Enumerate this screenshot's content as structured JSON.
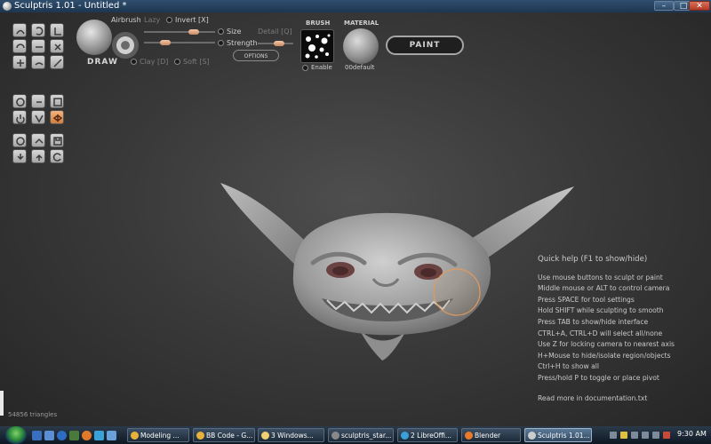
{
  "window": {
    "title": "Sculptris 1.01 - Untitled *",
    "minimize": "–",
    "maximize": "□",
    "close": "✕"
  },
  "brush": {
    "tool_name": "DRAW",
    "airbrush_label": "Airbrush",
    "lazy_label": "Lazy",
    "invert_label": "Invert [X]",
    "size_label": "Size",
    "detail_label": "Detail [Q]",
    "strength_label": "Strength",
    "clay_label": "Clay [D]",
    "soft_label": "Soft [S]",
    "options_label": "OPTIONS",
    "brush_header": "BRUSH",
    "enable_label": "Enable",
    "material_header": "MATERIAL",
    "material_name": "00default",
    "paint_label": "PAINT",
    "size_value": 0.7,
    "strength_value": 0.3,
    "detail_value": 0.6
  },
  "tools": [
    {
      "name": "draw-tool-icon",
      "active": false
    },
    {
      "name": "rotate-tool-icon",
      "active": false
    },
    {
      "name": "crease-tool-icon",
      "active": false
    },
    {
      "name": "inflate-tool-icon",
      "active": false
    },
    {
      "name": "flatten-tool-icon",
      "active": false
    },
    {
      "name": "pinch-tool-icon",
      "active": false
    },
    {
      "name": "grab-tool-icon",
      "active": false
    },
    {
      "name": "smooth-tool-icon",
      "active": false
    },
    {
      "name": "scale-tool-icon",
      "active": false
    },
    {
      "name": "rotate-object-icon",
      "active": false
    },
    {
      "name": "reduce-brush-icon",
      "active": false
    },
    {
      "name": "grid-icon",
      "active": false
    },
    {
      "name": "power-icon",
      "active": false
    },
    {
      "name": "wireframe-icon",
      "active": false
    },
    {
      "name": "symmetry-icon",
      "active": true
    },
    {
      "name": "sphere-icon",
      "active": false
    },
    {
      "name": "plane-icon",
      "active": false
    },
    {
      "name": "save-icon",
      "active": false
    },
    {
      "name": "import-icon",
      "active": false
    },
    {
      "name": "export-icon",
      "active": false
    },
    {
      "name": "undo-icon",
      "active": false
    }
  ],
  "quick_help": {
    "title": "Quick help (F1 to show/hide)",
    "lines": [
      "Use mouse buttons to sculpt or paint",
      "Middle mouse or ALT to control camera",
      "Press SPACE for tool settings",
      "Hold SHIFT while sculpting to smooth",
      "Press TAB to show/hide interface",
      "CTRL+A, CTRL+D will select all/none",
      "Use Z for locking camera to nearest axis",
      "H+Mouse to hide/isolate region/objects",
      "Ctrl+H to show all",
      "Press/hold P to toggle or place pivot"
    ],
    "footer": "Read more in documentation.txt"
  },
  "status": {
    "triangles": "54856 triangles"
  },
  "taskbar": {
    "tasks": [
      {
        "label": "Modeling ...",
        "color": "#e8b13c"
      },
      {
        "label": "BB Code - G...",
        "color": "#e8b13c"
      },
      {
        "label": "3 Windows...",
        "color": "#f0d070"
      },
      {
        "label": "sculptris_star...",
        "color": "#888888"
      },
      {
        "label": "2 LibreOffi...",
        "color": "#3aa0d8"
      },
      {
        "label": "Blender",
        "color": "#e87a2a"
      },
      {
        "label": "Sculptris 1.01...",
        "color": "#cccccc"
      }
    ],
    "clock": "9:30 AM"
  },
  "colors": {
    "accent": "#d27d3f",
    "viewport_bg": "#3a3a3a",
    "model": "#a8a8a8"
  }
}
